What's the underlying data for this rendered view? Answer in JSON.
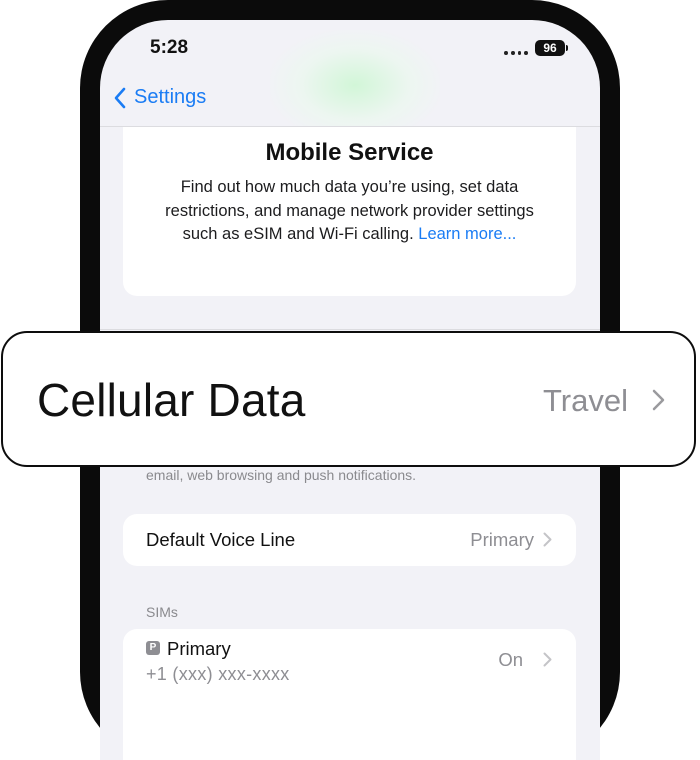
{
  "status_bar": {
    "time": "5:28",
    "battery": "96"
  },
  "nav": {
    "back_label": "Settings"
  },
  "info_card": {
    "title": "Mobile Service",
    "description": "Find out how much data you’re using, set data restrictions, and manage network provider settings such as eSIM and Wi-Fi calling.",
    "learn_more": "Learn more..."
  },
  "callout": {
    "label": "Cellular Data",
    "value": "Travel"
  },
  "cellular_footer": "email, web browsing and push notifications.",
  "voice_line": {
    "label": "Default Voice Line",
    "value": "Primary"
  },
  "sims": {
    "header": "SIMs",
    "items": [
      {
        "badge": "P",
        "name": "Primary",
        "number": "+1 (xxx) xxx-xxxx",
        "status": "On"
      }
    ]
  },
  "colors": {
    "accent": "#1a7cf4",
    "background": "#f2f2f7",
    "secondary_text": "#8e8e93"
  }
}
